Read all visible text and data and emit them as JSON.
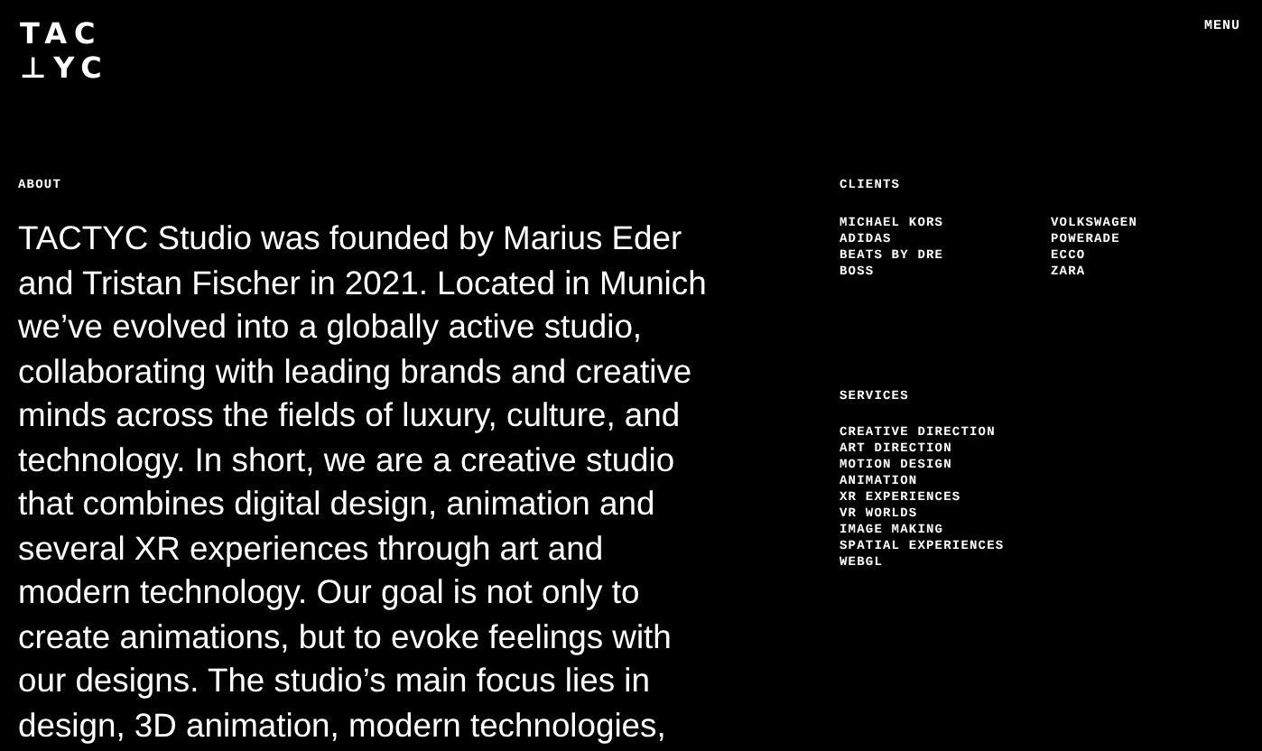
{
  "logo": {
    "lines": [
      "TAC",
      "⊥YC"
    ]
  },
  "menu": "MENU",
  "about": {
    "heading": "ABOUT",
    "text": "TACTYC Studio was founded by Marius Eder and Tristan Fischer in 2021. Located in Munich we’ve evolved into a globally active studio, collaborating with leading brands and creative minds across the fields of luxury, culture, and technology. In short, we are a creative studio that combines digital design, animation and several XR experiences through art and modern technology. Our goal is not only to create animations, but to evoke feelings with our designs. The studio’s main focus lies in design, 3D animation, modern technologies,"
  },
  "clients": {
    "heading": "CLIENTS",
    "column_1": [
      "MICHAEL KORS",
      "ADIDAS",
      "BEATS BY DRE",
      "BOSS"
    ],
    "column_2": [
      "VOLKSWAGEN",
      "POWERADE",
      "ECCO",
      "ZARA"
    ]
  },
  "services": {
    "heading": "SERVICES",
    "items": [
      "CREATIVE DIRECTION",
      "ART DIRECTION",
      "MOTION DESIGN",
      "ANIMATION",
      "XR EXPERIENCES",
      "VR WORLDS",
      "IMAGE MAKING",
      "SPATIAL EXPERIENCES",
      "WEBGL"
    ]
  }
}
